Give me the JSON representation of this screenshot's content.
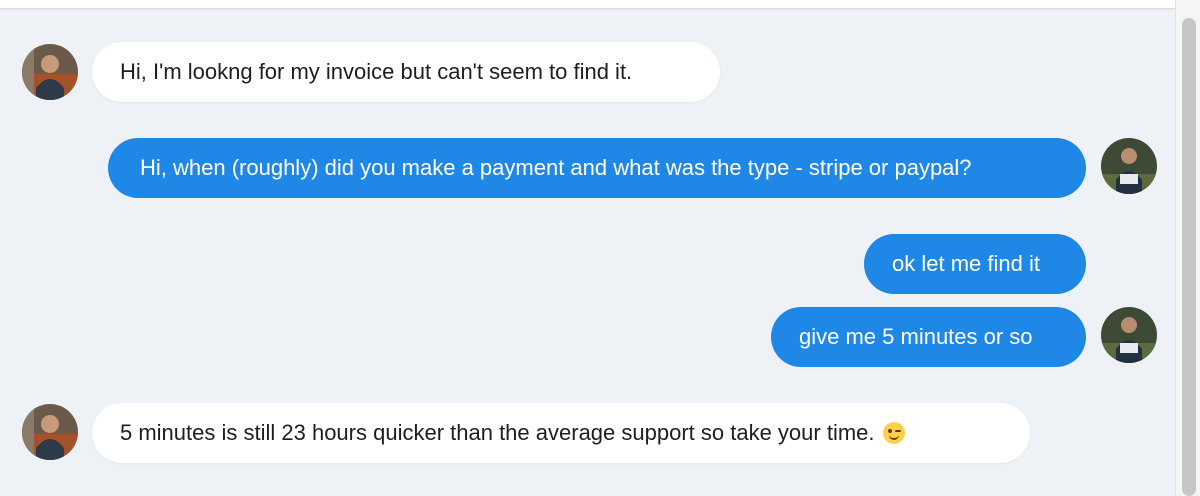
{
  "messages": [
    {
      "side": "in",
      "text": "Hi, I'm lookng for my invoice but can't seem to find it."
    },
    {
      "side": "out",
      "text": "Hi, when (roughly) did you make a payment and what was the type - stripe or paypal?"
    },
    {
      "side": "out",
      "text": "ok let me find it"
    },
    {
      "side": "out",
      "text": "give me 5 minutes or so"
    },
    {
      "side": "in",
      "text": "5 minutes is still 23 hours quicker than the average support so take your time.",
      "emoji": "winking-face"
    }
  ],
  "colors": {
    "background": "#eef1f5",
    "outgoing_bubble": "#1f87e5",
    "incoming_bubble": "#ffffff"
  },
  "icons": {
    "customer_avatar": "customer-avatar-icon",
    "agent_avatar": "agent-avatar-icon",
    "emoji": "winking-face-icon"
  }
}
